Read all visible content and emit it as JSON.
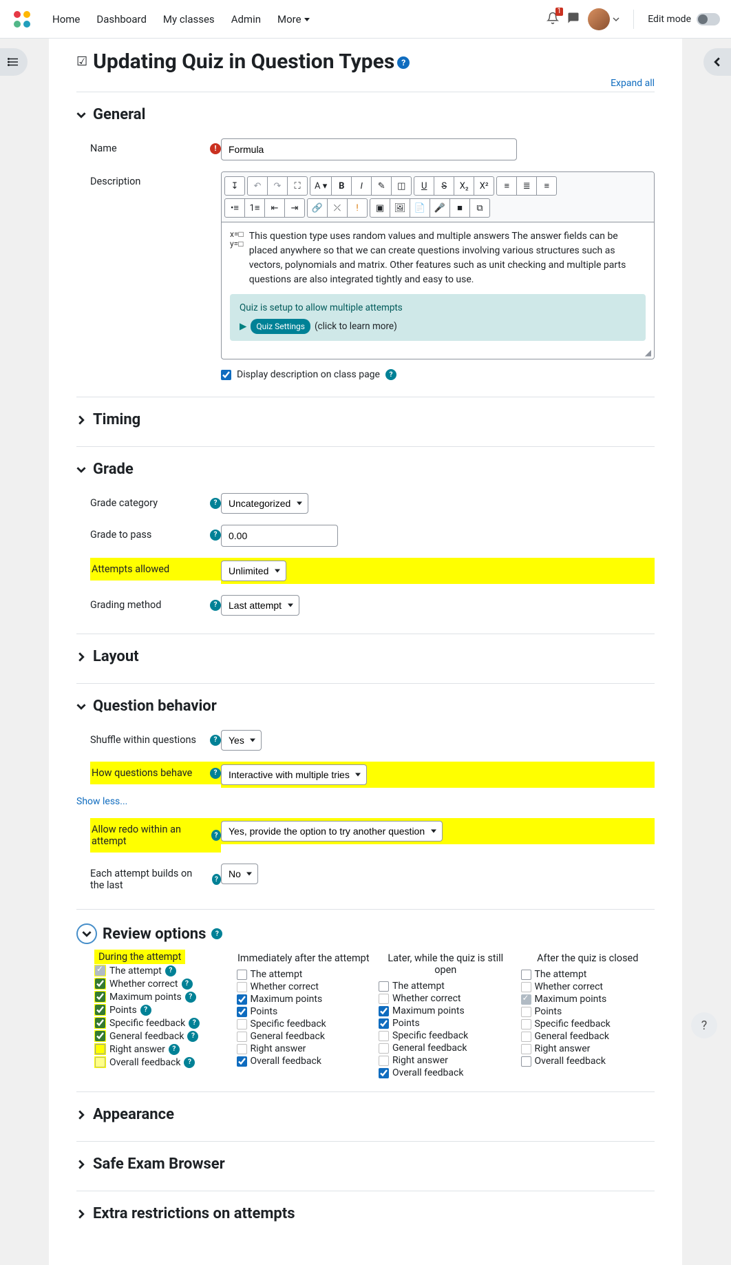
{
  "nav": {
    "home": "Home",
    "dashboard": "Dashboard",
    "myclasses": "My classes",
    "admin": "Admin",
    "more": "More",
    "notif_count": "1",
    "editmode": "Edit mode"
  },
  "page": {
    "title": "Updating Quiz in Question Types",
    "expand_all": "Expand all"
  },
  "section": {
    "general": "General",
    "timing": "Timing",
    "grade": "Grade",
    "layout": "Layout",
    "qbehavior": "Question behavior",
    "review": "Review options",
    "appearance": "Appearance",
    "seb": "Safe Exam Browser",
    "extra": "Extra restrictions on attempts"
  },
  "general": {
    "name_label": "Name",
    "name_value": "Formula",
    "desc_label": "Description",
    "desc_text": "This question type uses random values and multiple answers The answer fields can be placed anywhere so that we can create questions involving various structures such as vectors, polynomials and matrix. Other features such as unit checking and multiple parts questions are also integrated tightly and easy to use.",
    "info_title": "Quiz is setup to allow multiple attempts",
    "info_pill": "Quiz Settings",
    "info_more": "(click to learn more)",
    "cb_desc": "Display description on class page"
  },
  "grade": {
    "cat_label": "Grade category",
    "cat_value": "Uncategorized",
    "pass_label": "Grade to pass",
    "pass_value": "0.00",
    "attempts_label": "Attempts allowed",
    "attempts_value": "Unlimited",
    "method_label": "Grading method",
    "method_value": "Last attempt"
  },
  "qb": {
    "shuffle_label": "Shuffle within questions",
    "shuffle_value": "Yes",
    "behave_label": "How questions behave",
    "behave_value": "Interactive with multiple tries",
    "showless": "Show less...",
    "redo_label": "Allow redo within an attempt",
    "redo_value": "Yes, provide the option to try another question",
    "build_label": "Each attempt builds on the last",
    "build_value": "No"
  },
  "review": {
    "c1_title": "During the attempt",
    "c2_title": "Immediately after the attempt",
    "c3_title": "Later, while the quiz is still open",
    "c4_title": "After the quiz is closed",
    "items": {
      "attempt": "The attempt",
      "correct": "Whether correct",
      "maxpts": "Maximum points",
      "pts": "Points",
      "specfb": "Specific feedback",
      "genfb": "General feedback",
      "right": "Right answer",
      "overall": "Overall feedback"
    }
  }
}
